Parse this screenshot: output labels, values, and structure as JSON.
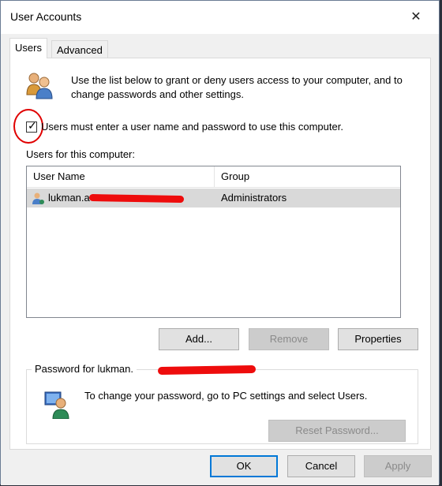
{
  "window": {
    "title": "User Accounts",
    "close_glyph": "✕"
  },
  "tabs": [
    {
      "label": "Users",
      "selected": true
    },
    {
      "label": "Advanced",
      "selected": false
    }
  ],
  "users_tab": {
    "intro_text": "Use the list below to grant or deny users access to your computer, and to change passwords and other settings.",
    "require_login_label": "Users must enter a user name and password to use this computer.",
    "require_login_checked": true,
    "check_glyph": "✓",
    "list_label": "Users for this computer:",
    "columns": [
      "User Name",
      "Group"
    ],
    "rows": [
      {
        "user_name": "lukman.a",
        "group": "Administrators"
      }
    ],
    "buttons": {
      "add": "Add...",
      "remove": "Remove",
      "properties": "Properties"
    },
    "password_group": {
      "title": "Password for lukman.",
      "text": "To change your password, go to PC settings and select Users.",
      "reset_button": "Reset Password..."
    }
  },
  "footer": {
    "ok": "OK",
    "cancel": "Cancel",
    "apply": "Apply"
  },
  "colors": {
    "accent": "#0078d7",
    "annotation_red": "#e00000",
    "selection_gray": "#d9d9d9"
  }
}
